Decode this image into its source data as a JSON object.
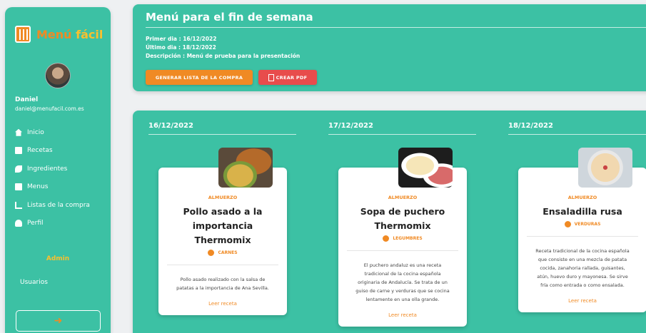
{
  "sidebar": {
    "logo": {
      "part1": "Menú",
      "part2": "fácil"
    },
    "user": {
      "name": "Daniel",
      "email": "daniel@menufacil.com.es"
    },
    "nav": [
      {
        "label": "Inicio",
        "icon": "home-icon"
      },
      {
        "label": "Recetas",
        "icon": "book-icon"
      },
      {
        "label": "Ingredientes",
        "icon": "leaf-icon"
      },
      {
        "label": "Menus",
        "icon": "mail-icon"
      },
      {
        "label": "Listas de la compra",
        "icon": "cart-icon"
      },
      {
        "label": "Perfil",
        "icon": "user-icon"
      }
    ],
    "admin_label": "Admin",
    "admin_item": "Usuarios",
    "logout_icon": "logout-icon"
  },
  "header": {
    "title": "Menú para el fin de semana",
    "first_day": "Primer dia : 16/12/2022",
    "last_day": "Último dia : 18/12/2022",
    "description": "Descripción : Menú de prueba para la presentación",
    "btn_list": "GENERAR LISTA DE LA COMPRA",
    "btn_pdf": "CREAR PDF"
  },
  "days": [
    {
      "date": "16/12/2022",
      "meal": "ALMUERZO",
      "title": "Pollo asado a la importancia Thermomix",
      "category": "CARNES",
      "description": "Pollo asado realizado con la salsa de patatas a la importancia de Ana Sevilla.",
      "link": "Leer receta"
    },
    {
      "date": "17/12/2022",
      "meal": "ALMUERZO",
      "title": "Sopa de puchero Thermomix",
      "category": "LEGUMBRES",
      "description": "El puchero andaluz es una receta tradicional de la cocina española originaria de Andalucía. Se trata de un guiso de carne y verduras que se cocina lentamente en una olla grande.",
      "link": "Leer receta"
    },
    {
      "date": "18/12/2022",
      "meal": "ALMUERZO",
      "title": "Ensaladilla rusa",
      "category": "VERDURAS",
      "description": "Receta tradicional de la cocina española que consiste en una mezcla de patata cocida, zanahoria rallada, guisantes, atún, huevo duro y mayonesa. Se sirve fría como entrada o como ensalada.",
      "link": "Leer receta"
    }
  ],
  "colors": {
    "primary": "#3cc1a4",
    "accent": "#f08a24",
    "danger": "#e84c4c"
  }
}
